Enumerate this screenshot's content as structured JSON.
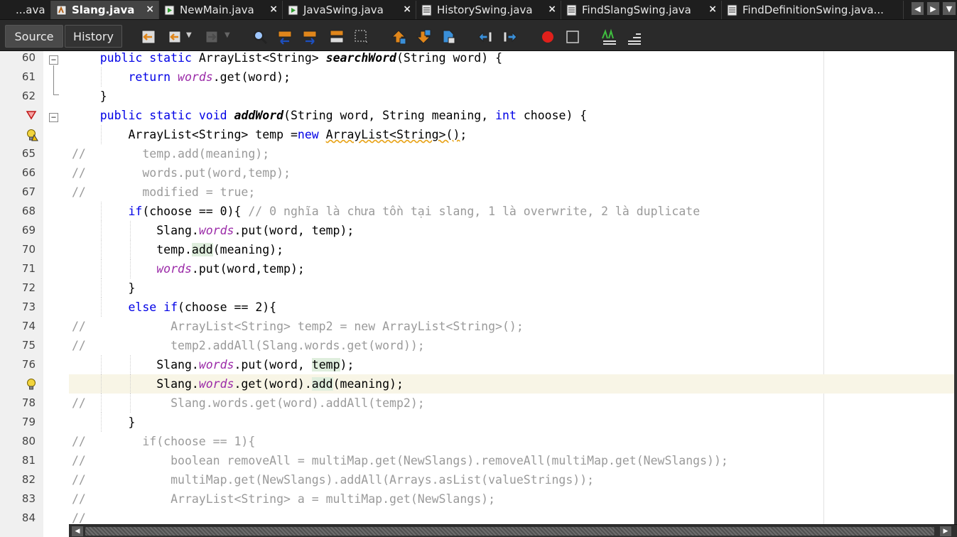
{
  "tabs": [
    {
      "label": "...ava",
      "active": false
    },
    {
      "label": "Slang.java",
      "active": true
    },
    {
      "label": "NewMain.java",
      "active": false
    },
    {
      "label": "JavaSwing.java",
      "active": false
    },
    {
      "label": "HistorySwing.java",
      "active": false
    },
    {
      "label": "FindSlangSwing.java",
      "active": false
    },
    {
      "label": "FindDefinitionSwing.java...",
      "active": false
    }
  ],
  "tab_close_glyph": "×",
  "toolbar": {
    "source_label": "Source",
    "history_label": "History"
  },
  "editor": {
    "line_numbers": [
      "60",
      "61",
      "62",
      "",
      "",
      "65",
      "66",
      "67",
      "68",
      "69",
      "70",
      "71",
      "72",
      "73",
      "74",
      "75",
      "76",
      "",
      "78",
      "79",
      "80",
      "81",
      "82",
      "83",
      "84"
    ],
    "lines": [
      "    public static ArrayList<String> searchWord(String word) {",
      "        return words.get(word);",
      "    }",
      "    public static void addWord(String word, String meaning, int choose) {",
      "        ArrayList<String> temp =new ArrayList<String>();",
      "//        temp.add(meaning);",
      "//        words.put(word,temp);",
      "//        modified = true;",
      "        if(choose == 0){ // 0 nghĩa là chưa tồn tại slang, 1 là overwrite, 2 là duplicate",
      "            Slang.words.put(word, temp);",
      "            temp.add(meaning);",
      "            words.put(word,temp);",
      "        }",
      "        else if(choose == 2){",
      "//            ArrayList<String> temp2 = new ArrayList<String>();",
      "//            temp2.addAll(Slang.words.get(word));",
      "            Slang.words.put(word, temp);",
      "            Slang.words.get(word).add(meaning);",
      "//            Slang.words.get(word).addAll(temp2);",
      "        }",
      "//        if(choose == 1){",
      "//            boolean removeAll = multiMap.get(NewSlangs).removeAll(multiMap.get(NewSlangs));",
      "//            multiMap.get(NewSlangs).addAll(Arrays.asList(valueStrings));",
      "//            ArrayList<String> a = multiMap.get(NewSlangs);",
      "//"
    ]
  },
  "colors": {
    "keyword": "#0000e6",
    "field": "#9b2ba8",
    "comment": "#9a9a9a",
    "highlight_line": "#f8f5e6",
    "occurrence": "#dfeedd"
  }
}
